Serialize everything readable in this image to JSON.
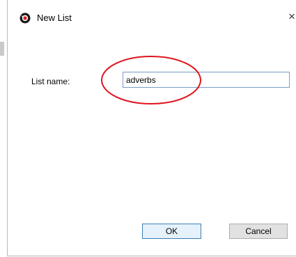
{
  "dialog": {
    "title": "New List",
    "close_glyph": "×",
    "app_icon": "app-logo-icon"
  },
  "form": {
    "name_label": "List name:",
    "name_value": "adverbs"
  },
  "buttons": {
    "ok_label": "OK",
    "cancel_label": "Cancel"
  },
  "annotation": {
    "color": "#e0141e"
  },
  "colors": {
    "ok_border": "#3c7fb1",
    "ok_fill": "#e5f1fb",
    "input_border": "#7a9cc6"
  }
}
